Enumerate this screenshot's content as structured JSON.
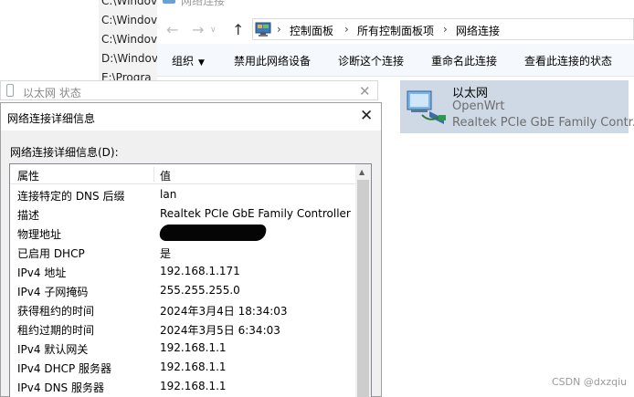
{
  "background_paths": [
    "C:\\Windov",
    "C:\\Windov",
    "C:\\Windov",
    "D:\\Windov",
    "E:\\Progra"
  ],
  "explorer": {
    "window_title": "网络连接",
    "breadcrumb": [
      "控制面板",
      "所有控制面板项",
      "网络连接"
    ],
    "commands": {
      "organize": "组织",
      "disable": "禁用此网络设备",
      "diagnose": "诊断这个连接",
      "rename": "重命名此连接",
      "view_status": "查看此连接的状态"
    },
    "adapter": {
      "name": "以太网",
      "network": "OpenWrt",
      "device": "Realtek PCIe GbE Family Contr..."
    }
  },
  "status_window": {
    "title": "以太网 状态"
  },
  "details_dialog": {
    "title": "网络连接详细信息",
    "section_label": "网络连接详细信息(D):",
    "columns": [
      "属性",
      "值"
    ],
    "rows": [
      {
        "prop": "连接特定的 DNS 后缀",
        "val": "lan"
      },
      {
        "prop": "描述",
        "val": "Realtek PCIe GbE Family Controller"
      },
      {
        "prop": "物理地址",
        "val": ""
      },
      {
        "prop": "已启用 DHCP",
        "val": "是"
      },
      {
        "prop": "IPv4 地址",
        "val": "192.168.1.171"
      },
      {
        "prop": "IPv4 子网掩码",
        "val": "255.255.255.0"
      },
      {
        "prop": "获得租约的时间",
        "val": "2024年3月4日 18:34:03"
      },
      {
        "prop": "租约过期的时间",
        "val": "2024年3月5日 6:34:03"
      },
      {
        "prop": "IPv4 默认网关",
        "val": "192.168.1.1"
      },
      {
        "prop": "IPv4 DHCP 服务器",
        "val": "192.168.1.1"
      },
      {
        "prop": "IPv4 DNS 服务器",
        "val": "192.168.1.1"
      }
    ]
  },
  "watermark": "CSDN @dxzqiu",
  "icons": {
    "back": "arrow-left-icon",
    "forward": "arrow-right-icon",
    "up": "arrow-up-icon",
    "close": "close-icon",
    "computer": "control-panel-icon",
    "adapter": "network-adapter-icon"
  },
  "colors": {
    "selection": "#cfd9e6",
    "cmdbar": "#f5f8fc",
    "dialog_bg": "#f0f0f0"
  }
}
